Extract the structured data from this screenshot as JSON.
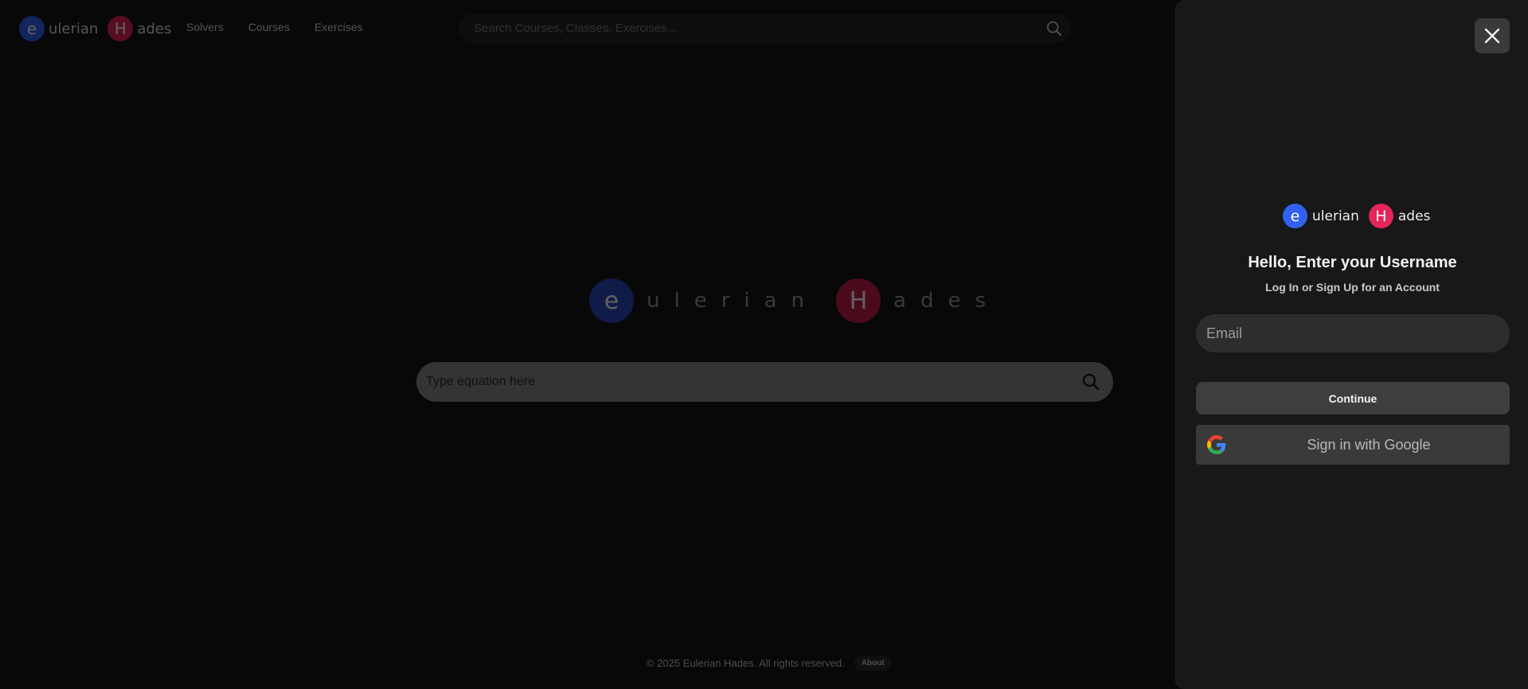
{
  "navbar": {
    "brand": {
      "letter1": "e",
      "word1": "ulerian",
      "letter2": "H",
      "word2": "ades"
    },
    "links": [
      "Solvers",
      "Courses",
      "Exercises"
    ],
    "search": {
      "placeholder": "Search Courses, Classes, Exercises..."
    }
  },
  "hero": {
    "letter1": "e",
    "word1": "ulerian",
    "letter2": "H",
    "word2": "ades",
    "equation_search": {
      "placeholder": "Type equation here"
    }
  },
  "footer": {
    "copyright": "© 2025 Eulerian Hades. All rights reserved.",
    "about": "About"
  },
  "drawer": {
    "logo": {
      "letter1": "e",
      "word1": "ulerian",
      "letter2": "H",
      "word2": "ades"
    },
    "title": "Hello, Enter your Username",
    "subtitle": "Log In or Sign Up for an Account",
    "email_placeholder": "Email",
    "continue_label": "Continue",
    "google_label": "Sign in with Google"
  },
  "colors": {
    "brand_blue": "#3061f2",
    "brand_red": "#e5245a",
    "hero_blue_dim": "#2a47c0",
    "hero_red_dim": "#c81f4d"
  },
  "icons": {
    "search": "search-icon",
    "close": "close-icon",
    "google": "google-icon"
  }
}
